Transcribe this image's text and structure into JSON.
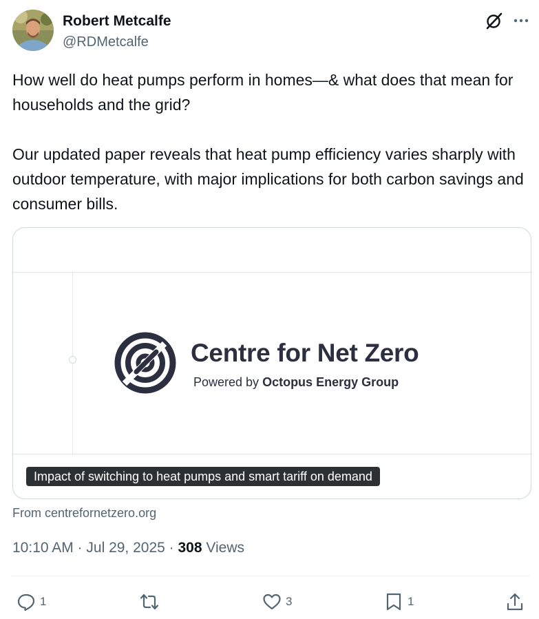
{
  "author": {
    "name": "Robert Metcalfe",
    "handle": "@RDMetcalfe"
  },
  "header_icons": [
    "grok-icon",
    "more-icon"
  ],
  "tweet": {
    "paragraph_1": "How well do heat pumps perform in homes—& what does that mean for households and the grid?",
    "paragraph_2": "Our updated paper reveals that heat pump efficiency varies sharply with outdoor temperature, with major implications for both carbon savings and consumer bills."
  },
  "card": {
    "logo_title": "Centre for Net Zero",
    "logo_sub_prefix": "Powered by ",
    "logo_sub_brand": "Octopus Energy Group",
    "caption": "Impact of switching to heat pumps and smart tariff on demand"
  },
  "source": "From centrefornetzero.org",
  "meta": {
    "timestamp": "10:10 AM · Jul 29, 2025 · ",
    "views_count": "308",
    "views_label": " Views"
  },
  "actions": {
    "replies": "1",
    "reposts": "",
    "likes": "3",
    "bookmarks": "1"
  },
  "colors": {
    "text": "#0f1419",
    "secondary": "#536471",
    "border": "#cfd9de",
    "logo": "#2b2f3f"
  }
}
